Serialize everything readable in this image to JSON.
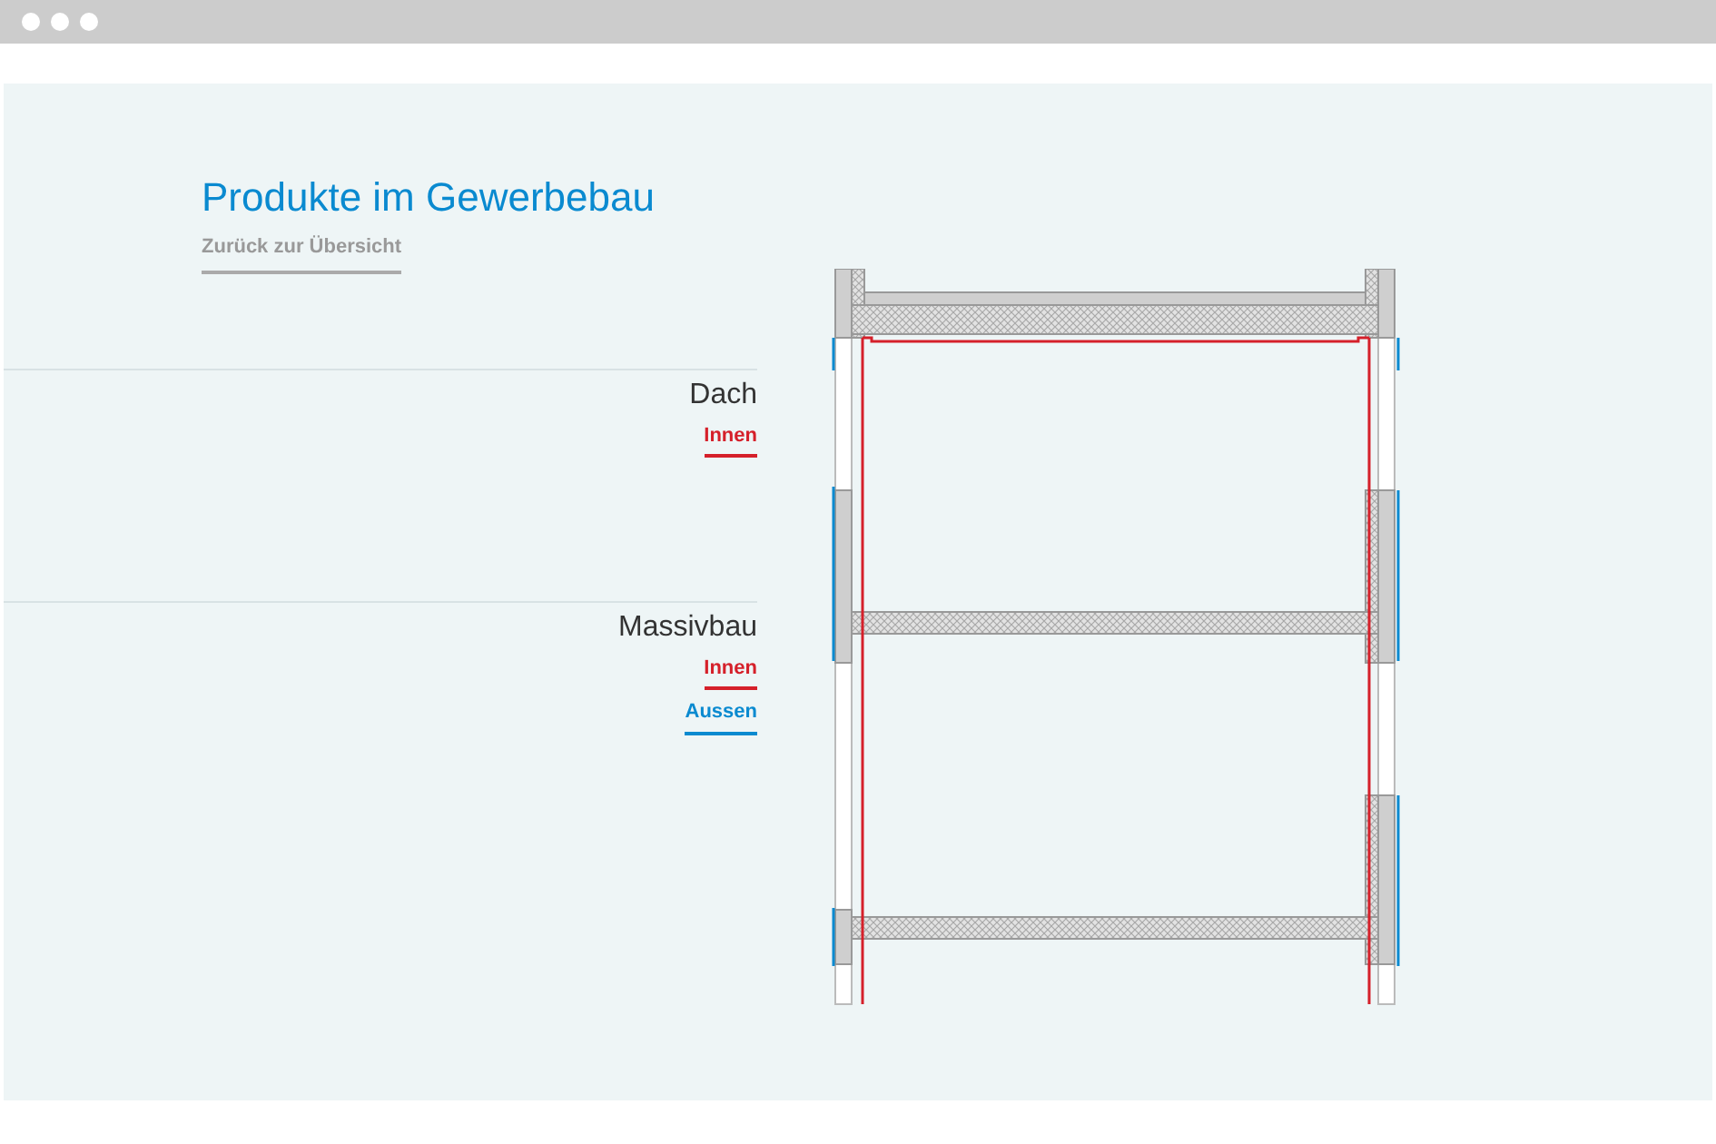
{
  "page": {
    "title": "Produkte im Gewerbebau",
    "back_link": "Zurück zur Übersicht"
  },
  "sections": [
    {
      "title": "Dach",
      "links": [
        {
          "label": "Innen",
          "kind": "inside"
        }
      ]
    },
    {
      "title": "Massivbau",
      "links": [
        {
          "label": "Innen",
          "kind": "inside"
        },
        {
          "label": "Aussen",
          "kind": "outside"
        }
      ]
    }
  ]
}
